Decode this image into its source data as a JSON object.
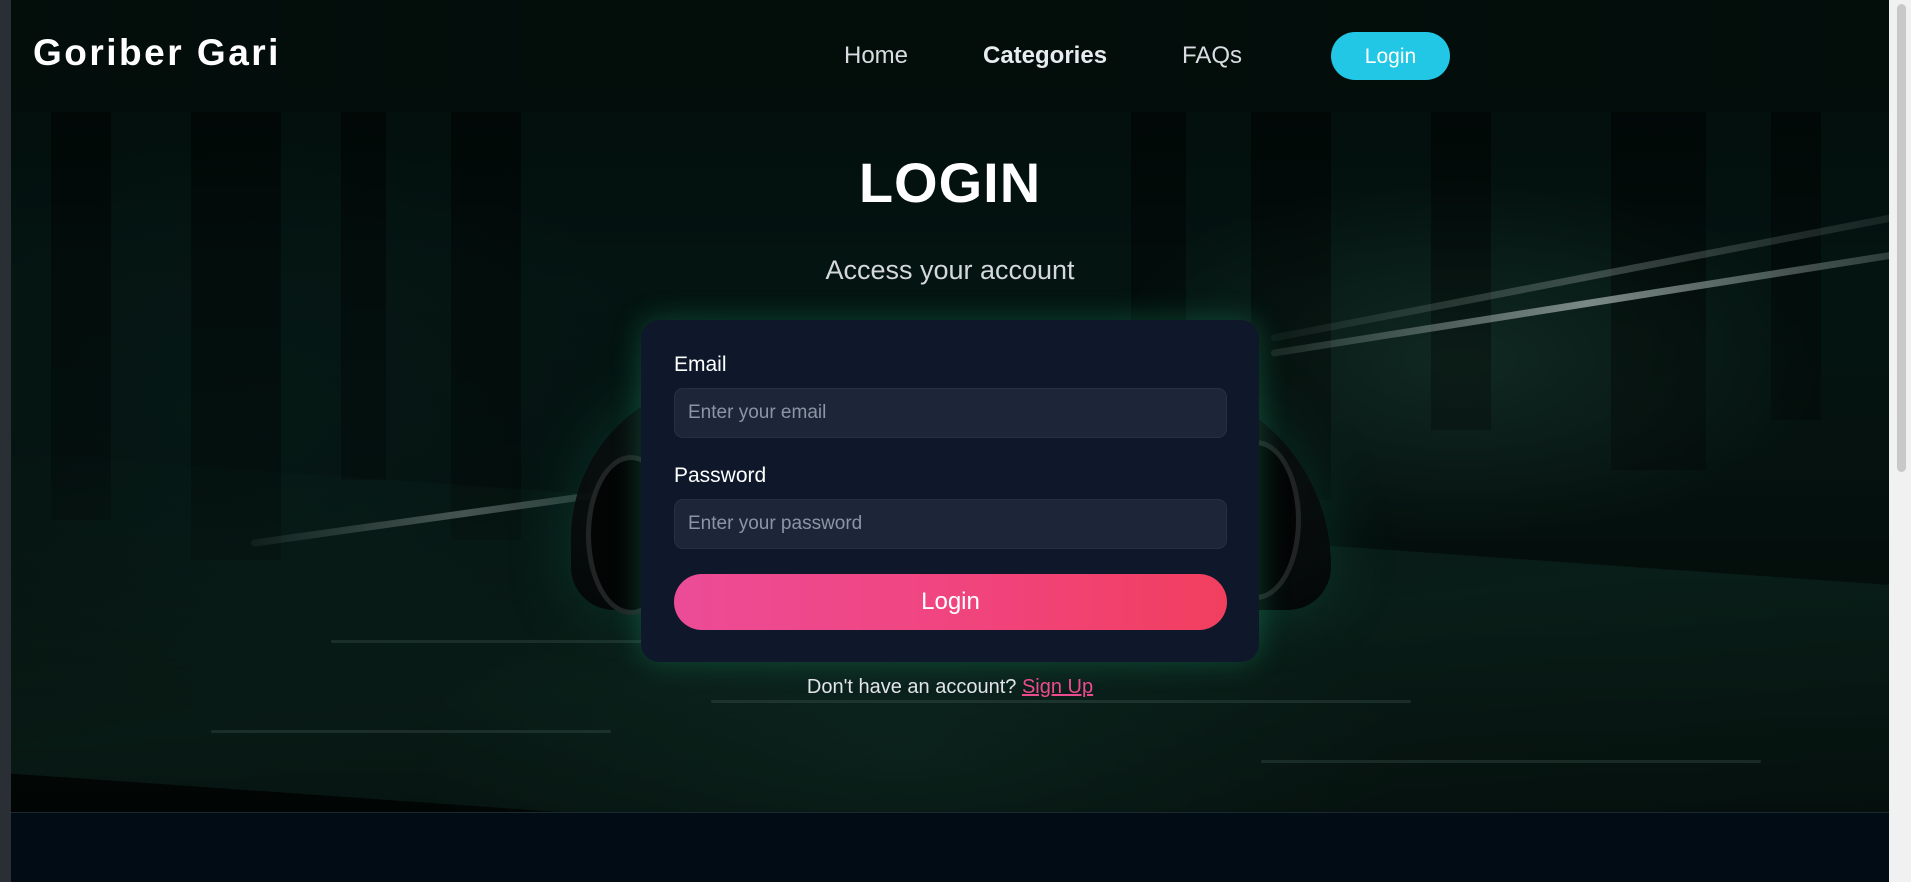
{
  "navbar": {
    "brand": "Goriber Gari",
    "links": [
      {
        "label": "Home",
        "active": false
      },
      {
        "label": "Categories",
        "active": true
      },
      {
        "label": "FAQs",
        "active": false
      }
    ],
    "login_button": "Login"
  },
  "login": {
    "title": "LOGIN",
    "subtitle": "Access your account",
    "email": {
      "label": "Email",
      "placeholder": "Enter your email",
      "value": ""
    },
    "password": {
      "label": "Password",
      "placeholder": "Enter your password",
      "value": ""
    },
    "submit_label": "Login",
    "signup_prompt": "Don't have an account?",
    "signup_link": "Sign Up"
  },
  "colors": {
    "accent_cyan": "#22c7e5",
    "accent_pink": "#ec4c97",
    "card_bg": "#0f182a"
  }
}
